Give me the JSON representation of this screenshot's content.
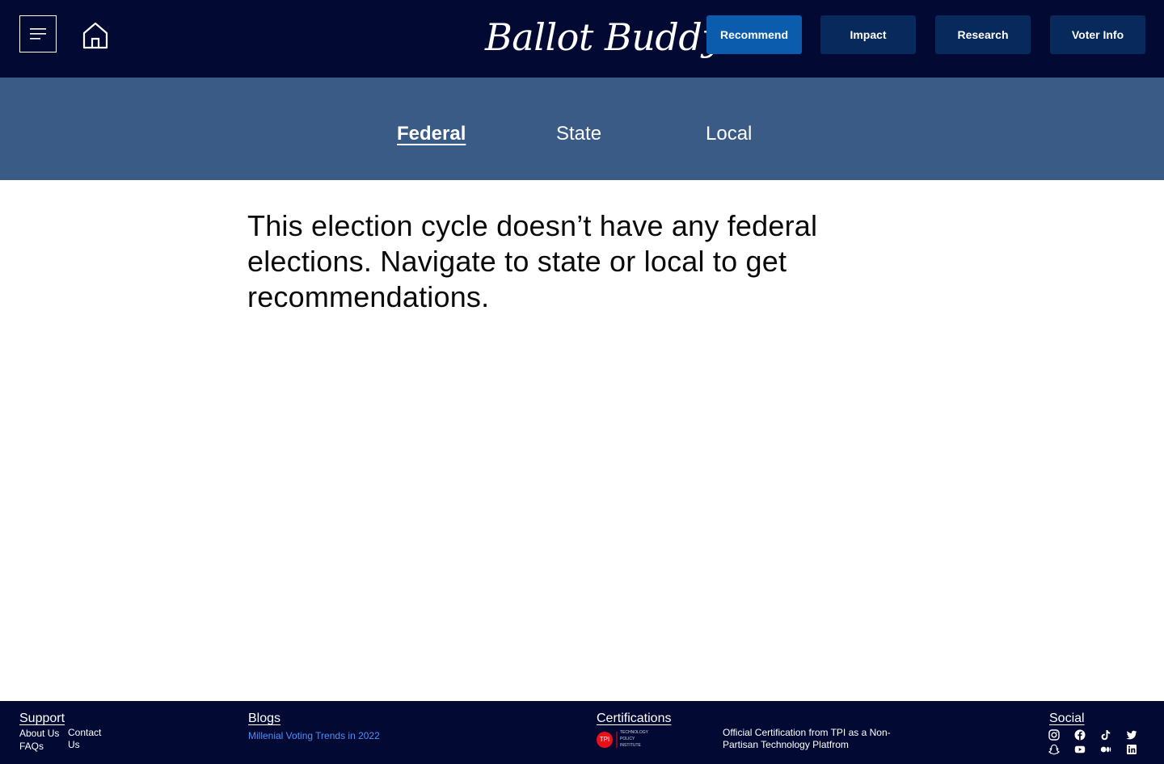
{
  "header": {
    "brand": "Ballot Buddy",
    "nav": {
      "recommend": "Recommend",
      "impact": "Impact",
      "research": "Research",
      "voter_info": "Voter Info"
    }
  },
  "tabs": {
    "federal": "Federal",
    "state": "State",
    "local": "Local",
    "active": "federal"
  },
  "main": {
    "message": "This election cycle doesn’t have any federal elections. Navigate to state or local to get recommendations."
  },
  "footer": {
    "support": {
      "heading": "Support",
      "about": "About Us",
      "faqs": "FAQs",
      "contact_line1": "Contact",
      "contact_line2": "Us"
    },
    "blogs": {
      "heading": "Blogs",
      "post": "Millenial Voting Trends in 2022"
    },
    "certifications": {
      "heading": "Certifications",
      "logo_text": "TPI",
      "logo_sub1": "TECHNOLOGY",
      "logo_sub2": "POLICY",
      "logo_sub3": "INSTITUTE",
      "text": "Official Certification from TPI as a Non-Partisan Technology Platfrom"
    },
    "social": {
      "heading": "Social",
      "icons": [
        "instagram-icon",
        "facebook-icon",
        "tiktok-icon",
        "twitter-icon",
        "snapchat-icon",
        "youtube-icon",
        "medium-icon",
        "linkedin-icon"
      ]
    }
  },
  "colors": {
    "header_bg": "#020a33",
    "tab_bg": "#3b5b87",
    "nav_button": "#07295c",
    "nav_button_active": "#0b5cad",
    "blog_link": "#4f8ff7",
    "tpi_red": "#e8101a"
  }
}
